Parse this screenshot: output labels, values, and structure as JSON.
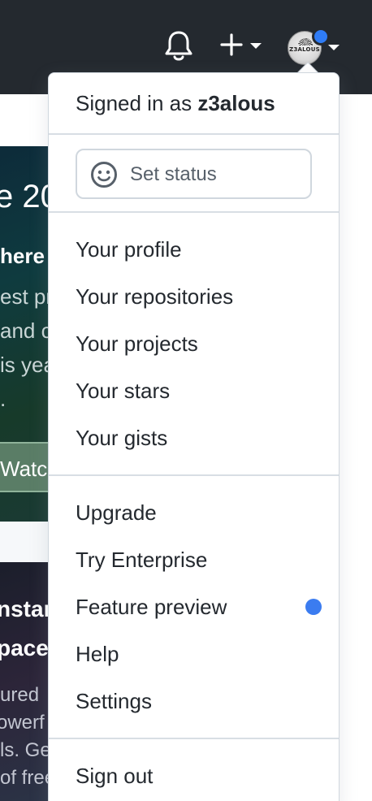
{
  "header": {
    "bell_icon": "bell-icon",
    "create_icon": "plus-icon",
    "avatar": {
      "text": "Z3ALOUS",
      "has_notification": true
    }
  },
  "background": {
    "hero": {
      "title": "e 20",
      "subtitle": "here",
      "lines": [
        "est pr",
        "and c",
        "is yea",
        "."
      ],
      "button": "Watch"
    },
    "code_card": {
      "title_lines": [
        "nstan",
        "pace"
      ],
      "lines": [
        "ured",
        "owerf",
        "ls. Ge",
        "of free"
      ]
    }
  },
  "dropdown": {
    "signed_in_prefix": "Signed in as ",
    "username": "z3alous",
    "status": {
      "label": "Set status",
      "icon": "smiley-icon"
    },
    "section_profile": [
      "Your profile",
      "Your repositories",
      "Your projects",
      "Your stars",
      "Your gists"
    ],
    "section_account": [
      "Upgrade",
      "Try Enterprise",
      "Feature preview",
      "Help",
      "Settings"
    ],
    "sign_out": "Sign out"
  },
  "colors": {
    "header_bg": "#24292f",
    "notification_blue": "#3b7cf0",
    "text": "#24292f",
    "muted_text": "#57606a",
    "border": "#d0d7de"
  }
}
